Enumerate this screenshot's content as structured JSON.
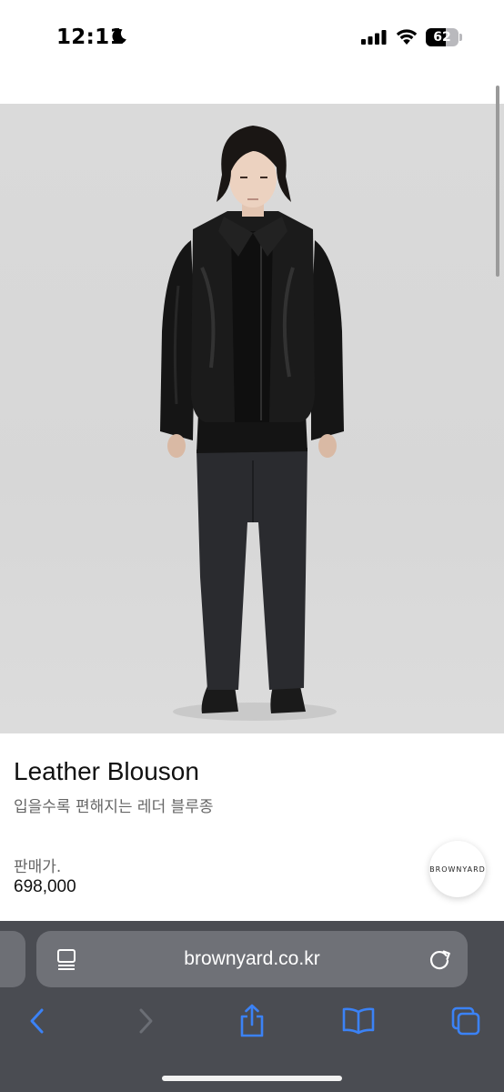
{
  "status_bar": {
    "time": "12:11",
    "battery_percent": "62",
    "battery_level": 0.62,
    "icons": [
      "moon-icon",
      "cellular-signal-icon",
      "wifi-icon",
      "battery-icon"
    ]
  },
  "product": {
    "title": "Leather Blouson",
    "subtitle": "입을수록 편해지는 레더 블루종",
    "price_label": "판매가.",
    "price": "698,000",
    "brand_badge": "BROWNYARD"
  },
  "browser": {
    "url": "brownyard.co.kr",
    "icons": {
      "tab_overview": "tab-list-icon",
      "reload": "reload-icon",
      "back": "back-chevron-icon",
      "forward": "forward-chevron-icon",
      "share": "share-icon",
      "bookmarks": "bookmarks-book-icon",
      "tabs": "tabs-icon"
    },
    "forward_enabled": false
  },
  "colors": {
    "toolbar_bg": "#4a4c52",
    "address_bar_bg": "#6f7177",
    "accent_blue": "#3b82f6",
    "image_bg": "#d8d8d8"
  }
}
